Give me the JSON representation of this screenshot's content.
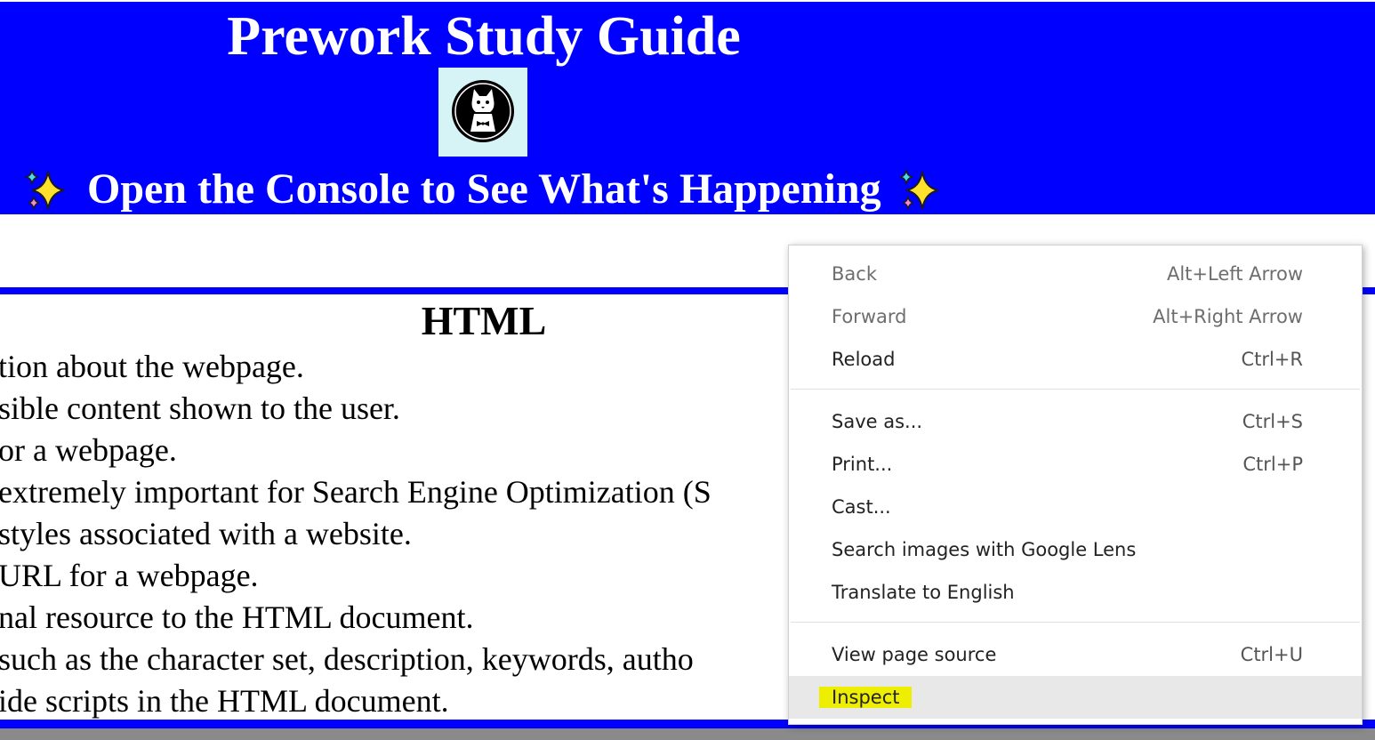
{
  "header": {
    "title": "Prework Study Guide",
    "subtitle": "Open the Console to See What's Happening",
    "sparkle_icon": "sparkles-icon",
    "avatar_icon": "cat-avatar-icon",
    "background": "#0000ff",
    "avatar_background": "#d6f3f5"
  },
  "section": {
    "heading": "HTML",
    "lines": [
      "tion about the webpage.",
      "sible content shown to the user.",
      "or a webpage.",
      "extremely important for Search Engine Optimization (S",
      "styles associated with a website.",
      "URL for a webpage.",
      "nal resource to the HTML document.",
      "such as the character set, description, keywords, autho",
      "ide scripts in the HTML document."
    ]
  },
  "context_menu": {
    "items": [
      {
        "label": "Back",
        "shortcut": "Alt+Left Arrow",
        "disabled": true
      },
      {
        "label": "Forward",
        "shortcut": "Alt+Right Arrow",
        "disabled": true
      },
      {
        "label": "Reload",
        "shortcut": "Ctrl+R",
        "disabled": false
      },
      {
        "label": "Save as...",
        "shortcut": "Ctrl+S",
        "disabled": false
      },
      {
        "label": "Print...",
        "shortcut": "Ctrl+P",
        "disabled": false
      },
      {
        "label": "Cast...",
        "shortcut": "",
        "disabled": false
      },
      {
        "label": "Search images with Google Lens",
        "shortcut": "",
        "disabled": false
      },
      {
        "label": "Translate to English",
        "shortcut": "",
        "disabled": false
      },
      {
        "label": "View page source",
        "shortcut": "Ctrl+U",
        "disabled": false
      },
      {
        "label": "Inspect",
        "shortcut": "",
        "disabled": false,
        "highlighted": true
      }
    ],
    "highlight_color": "#eeee00"
  }
}
